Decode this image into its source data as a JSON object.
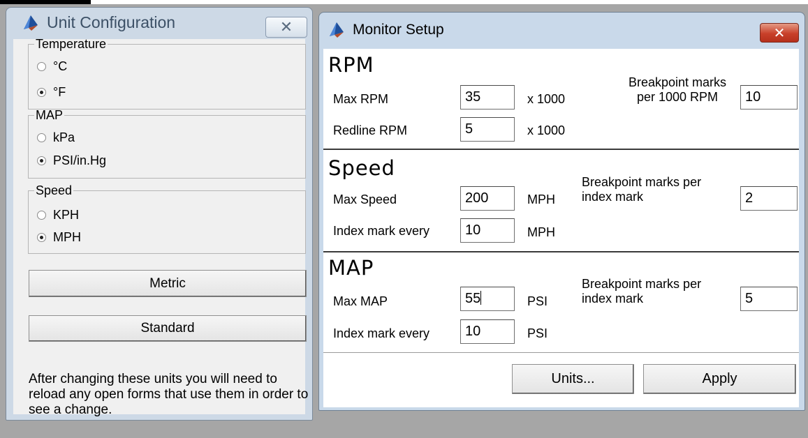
{
  "unit_config": {
    "title": "Unit Configuration",
    "close_glyph": "✕",
    "groups": {
      "temperature": {
        "label": "Temperature",
        "options": [
          "°C",
          "°F"
        ],
        "selected": 1
      },
      "map": {
        "label": "MAP",
        "options": [
          "kPa",
          "PSI/in.Hg"
        ],
        "selected": 1
      },
      "speed": {
        "label": "Speed",
        "options": [
          "KPH",
          "MPH"
        ],
        "selected": 1
      }
    },
    "metric_button": "Metric",
    "standard_button": "Standard",
    "note": "After changing these units you will need to reload any open forms that use them in order to see a change."
  },
  "monitor_setup": {
    "title": "Monitor Setup",
    "close_glyph": "✕",
    "rpm": {
      "heading": "RPM",
      "max_label": "Max RPM",
      "max_value": "35",
      "max_unit": "x 1000",
      "redline_label": "Redline RPM",
      "redline_value": "5",
      "redline_unit": "x 1000",
      "breakpoint_line1": "Breakpoint marks",
      "breakpoint_line2": "per 1000 RPM",
      "breakpoint_value": "10"
    },
    "speed": {
      "heading": "Speed",
      "max_label": "Max Speed",
      "max_value": "200",
      "max_unit": "MPH",
      "index_label": "Index mark every",
      "index_value": "10",
      "index_unit": "MPH",
      "breakpoint_line1": "Breakpoint marks per",
      "breakpoint_line2": "index mark",
      "breakpoint_value": "2"
    },
    "map": {
      "heading": "MAP",
      "max_label": "Max MAP",
      "max_value": "55",
      "max_unit": "PSI",
      "index_label": "Index mark every",
      "index_value": "10",
      "index_unit": "PSI",
      "breakpoint_line1": "Breakpoint marks per",
      "breakpoint_line2": "index mark",
      "breakpoint_value": "5"
    },
    "units_button": "Units...",
    "apply_button": "Apply"
  }
}
